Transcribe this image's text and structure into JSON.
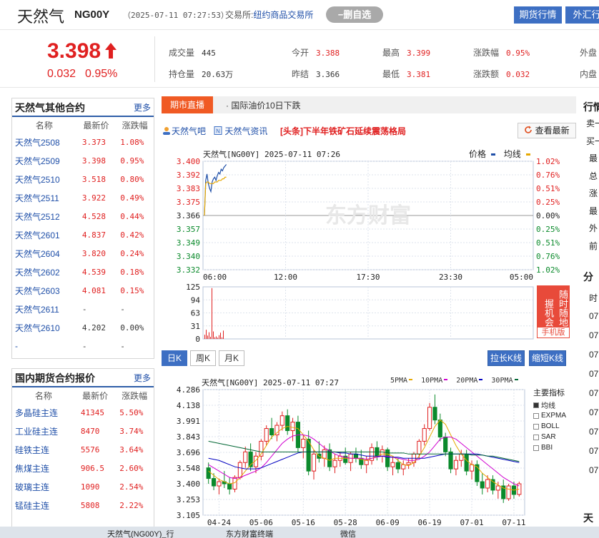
{
  "header": {
    "name": "天然气",
    "code": "NG00Y",
    "time": "（2025-07-11 07:27:53）",
    "exchange_label": "交易所:",
    "exchange": "纽约商品交易所",
    "watch_btn": "−删自选",
    "btn_futures": "期货行情",
    "btn_fx": "外汇行"
  },
  "quote": {
    "price": "3.398",
    "change": "0.032",
    "change_pct": "0.95%",
    "items": [
      {
        "label": "成交量",
        "value": "445"
      },
      {
        "label": "持仓量",
        "value": "20.63万"
      },
      {
        "label": "今开",
        "value": "3.388"
      },
      {
        "label": "昨结",
        "value": "3.366"
      },
      {
        "label": "最高",
        "value": "3.399"
      },
      {
        "label": "最低",
        "value": "3.381"
      },
      {
        "label": "涨跌幅",
        "value": "0.95%"
      },
      {
        "label": "涨跌额",
        "value": "0.032"
      },
      {
        "label": "外盘",
        "value": ""
      },
      {
        "label": "内盘",
        "value": ""
      }
    ]
  },
  "other_contracts": {
    "title": "天然气其他合约",
    "more": "更多",
    "headers": [
      "名称",
      "最新价",
      "涨跌幅"
    ],
    "rows": [
      [
        "天然气2508",
        "3.373",
        "1.08%"
      ],
      [
        "天然气2509",
        "3.398",
        "0.95%"
      ],
      [
        "天然气2510",
        "3.518",
        "0.80%"
      ],
      [
        "天然气2511",
        "3.922",
        "0.49%"
      ],
      [
        "天然气2512",
        "4.528",
        "0.44%"
      ],
      [
        "天然气2601",
        "4.837",
        "0.42%"
      ],
      [
        "天然气2604",
        "3.820",
        "0.24%"
      ],
      [
        "天然气2602",
        "4.539",
        "0.18%"
      ],
      [
        "天然气2603",
        "4.081",
        "0.15%"
      ],
      [
        "天然气2611",
        "-",
        "-"
      ],
      [
        "天然气2610",
        "4.202",
        "0.00%"
      ],
      [
        "-",
        "-",
        "-"
      ]
    ]
  },
  "domestic": {
    "title": "国内期货合约报价",
    "more": "更多",
    "headers": [
      "名称",
      "最新价",
      "涨跌幅"
    ],
    "rows": [
      [
        "多晶硅主连",
        "41345",
        "5.50%"
      ],
      [
        "工业硅主连",
        "8470",
        "3.74%"
      ],
      [
        "硅铁主连",
        "5576",
        "3.64%"
      ],
      [
        "焦煤主连",
        "906.5",
        "2.60%"
      ],
      [
        "玻璃主连",
        "1090",
        "2.54%"
      ],
      [
        "锰硅主连",
        "5808",
        "2.22%"
      ]
    ]
  },
  "news": {
    "tag": "期市直播",
    "ticker": "· 国际油价10日下跌",
    "link1": "天然气吧",
    "link2": "天然气资讯",
    "headline": "[头条]下半年铁矿石延续震荡格局",
    "refresh": "查看最新"
  },
  "intraday": {
    "title": "天然气[NG00Y] 2025-07-11 07:26",
    "legend_price": "价格",
    "legend_avg": "均线",
    "ad_text": "随时随地把握机会",
    "ad_label": "手机版",
    "watermark": "东方财富"
  },
  "kline_tabs": {
    "tabs": [
      "日K",
      "周K",
      "月K"
    ],
    "btn_wide": "拉长K线",
    "btn_narrow": "缩短K线"
  },
  "kline": {
    "title": "天然气[NG00Y] 2025-07-11 07:27",
    "ma": [
      "5PMA",
      "10PMA",
      "20PMA",
      "30PMA"
    ],
    "indicator_title": "主要指标",
    "indicators": [
      "均线",
      "EXPMA",
      "BOLL",
      "SAR",
      "BBI"
    ]
  },
  "right_panel": {
    "title1": "行情",
    "rows1": [
      "卖一",
      "买一",
      "最",
      "总",
      "涨",
      "最",
      "外",
      "前"
    ],
    "title2": "分",
    "rows2": [
      "时",
      "07",
      "07",
      "07",
      "07",
      "07",
      "07",
      "07",
      "07",
      "07"
    ],
    "title3": "天"
  },
  "taskbar": [
    "天然气(NG00Y)_行",
    "东方财富终端",
    "微信"
  ],
  "colors": {
    "up": "#e02020",
    "down": "#0b8a2c",
    "accent": "#3d6fc3",
    "tag": "#f05a24"
  },
  "chart_data": [
    {
      "type": "line",
      "title": "天然气[NG00Y] 2025-07-11 07:26",
      "x_ticks": [
        "06:00",
        "12:00",
        "17:30",
        "23:30",
        "05:00"
      ],
      "y_ticks_left": [
        "3.400",
        "3.392",
        "3.383",
        "3.375",
        "3.366",
        "3.357",
        "3.349",
        "3.340",
        "3.332"
      ],
      "y_ticks_right": [
        "1.02%",
        "0.76%",
        "0.51%",
        "0.25%",
        "0.00%",
        "0.25%",
        "0.51%",
        "0.76%",
        "1.02%"
      ],
      "ylim": [
        3.332,
        3.4
      ],
      "series": [
        {
          "name": "价格",
          "values": [
            3.366,
            3.388,
            3.392,
            3.386,
            3.383,
            3.381,
            3.387,
            3.389,
            3.39,
            3.388,
            3.391,
            3.393,
            3.392,
            3.395,
            3.394,
            3.396,
            3.397,
            3.398
          ]
        },
        {
          "name": "均线",
          "values": [
            3.366,
            3.386,
            3.387,
            3.387,
            3.386,
            3.386,
            3.386,
            3.386,
            3.387,
            3.387,
            3.387,
            3.388,
            3.388,
            3.388,
            3.389,
            3.389,
            3.39,
            3.39
          ]
        }
      ]
    },
    {
      "type": "bar",
      "yticks": [
        "125",
        "94",
        "63",
        "31",
        "0"
      ],
      "ylim": [
        0,
        125
      ],
      "values": [
        10,
        22,
        8,
        16,
        5,
        122,
        18,
        4,
        6,
        3,
        9,
        15,
        4,
        20
      ]
    },
    {
      "type": "candlestick",
      "title": "天然气[NG00Y] 2025-07-11 07:27",
      "y_ticks": [
        "4.286",
        "4.138",
        "3.991",
        "3.843",
        "3.696",
        "3.548",
        "3.400",
        "3.253",
        "3.105"
      ],
      "ylim": [
        3.105,
        4.286
      ],
      "x_ticks": [
        "04-24",
        "05-06",
        "05-16",
        "05-28",
        "06-09",
        "06-19",
        "07-01",
        "07-11"
      ],
      "ohlc": [
        [
          3.55,
          3.6,
          3.4,
          3.45
        ],
        [
          3.45,
          3.5,
          3.34,
          3.38
        ],
        [
          3.38,
          3.45,
          3.3,
          3.42
        ],
        [
          3.42,
          3.52,
          3.36,
          3.4
        ],
        [
          3.4,
          3.46,
          3.3,
          3.35
        ],
        [
          3.35,
          3.48,
          3.32,
          3.46
        ],
        [
          3.46,
          3.62,
          3.44,
          3.6
        ],
        [
          3.6,
          3.75,
          3.55,
          3.7
        ],
        [
          3.7,
          3.78,
          3.52,
          3.56
        ],
        [
          3.56,
          3.7,
          3.5,
          3.66
        ],
        [
          3.66,
          3.82,
          3.62,
          3.8
        ],
        [
          3.8,
          3.95,
          3.76,
          3.92
        ],
        [
          3.92,
          4.02,
          3.82,
          3.86
        ],
        [
          3.86,
          3.98,
          3.8,
          3.95
        ],
        [
          3.95,
          4.08,
          3.9,
          4.04
        ],
        [
          4.04,
          4.1,
          3.86,
          3.9
        ],
        [
          3.9,
          4.02,
          3.8,
          3.98
        ],
        [
          3.98,
          4.04,
          3.7,
          3.74
        ],
        [
          3.74,
          3.86,
          3.64,
          3.82
        ],
        [
          3.82,
          3.9,
          3.48,
          3.52
        ],
        [
          3.52,
          3.72,
          3.44,
          3.68
        ],
        [
          3.68,
          3.8,
          3.6,
          3.64
        ],
        [
          3.64,
          3.76,
          3.56,
          3.72
        ],
        [
          3.72,
          3.78,
          3.52,
          3.56
        ],
        [
          3.56,
          3.68,
          3.5,
          3.62
        ],
        [
          3.62,
          3.7,
          3.56,
          3.66
        ],
        [
          3.66,
          3.74,
          3.58,
          3.6
        ],
        [
          3.6,
          3.7,
          3.52,
          3.68
        ],
        [
          3.68,
          3.74,
          3.6,
          3.64
        ],
        [
          3.64,
          3.72,
          3.54,
          3.58
        ],
        [
          3.58,
          3.66,
          3.5,
          3.62
        ],
        [
          3.62,
          3.78,
          3.58,
          3.74
        ],
        [
          3.74,
          3.8,
          3.62,
          3.66
        ],
        [
          3.66,
          3.76,
          3.6,
          3.72
        ],
        [
          3.72,
          3.74,
          3.52,
          3.56
        ],
        [
          3.56,
          3.66,
          3.48,
          3.6
        ],
        [
          3.6,
          3.64,
          3.5,
          3.54
        ],
        [
          3.54,
          3.62,
          3.48,
          3.58
        ],
        [
          3.58,
          3.64,
          3.54,
          3.6
        ],
        [
          3.6,
          3.7,
          3.56,
          3.68
        ],
        [
          3.68,
          3.82,
          3.64,
          3.8
        ],
        [
          3.8,
          3.96,
          3.76,
          3.92
        ],
        [
          3.92,
          4.16,
          3.9,
          4.12
        ],
        [
          4.12,
          4.24,
          3.96,
          4.0
        ],
        [
          4.0,
          4.06,
          3.8,
          3.84
        ],
        [
          3.84,
          3.88,
          3.66,
          3.7
        ],
        [
          3.7,
          3.74,
          3.5,
          3.54
        ],
        [
          3.54,
          3.66,
          3.48,
          3.62
        ],
        [
          3.62,
          3.72,
          3.56,
          3.68
        ],
        [
          3.68,
          3.72,
          3.48,
          3.52
        ],
        [
          3.52,
          3.62,
          3.44,
          3.58
        ],
        [
          3.58,
          3.62,
          3.38,
          3.42
        ],
        [
          3.42,
          3.5,
          3.3,
          3.36
        ],
        [
          3.36,
          3.48,
          3.32,
          3.44
        ],
        [
          3.44,
          3.48,
          3.3,
          3.34
        ],
        [
          3.34,
          3.42,
          3.26,
          3.38
        ],
        [
          3.38,
          3.44,
          3.22,
          3.26
        ],
        [
          3.26,
          3.4,
          3.24,
          3.38
        ],
        [
          3.38,
          3.42,
          3.26,
          3.3
        ],
        [
          3.3,
          3.42,
          3.28,
          3.4
        ]
      ],
      "ma_series": [
        {
          "name": "5PMA",
          "color": "#e6a800",
          "values": [
            3.52,
            3.48,
            3.44,
            3.42,
            3.4,
            3.41,
            3.46,
            3.52,
            3.58,
            3.62,
            3.68,
            3.76,
            3.84,
            3.88,
            3.92,
            3.94,
            3.93,
            3.92,
            3.86,
            3.8,
            3.72,
            3.66,
            3.64,
            3.62,
            3.64,
            3.64,
            3.64,
            3.64,
            3.64,
            3.63,
            3.62,
            3.64,
            3.66,
            3.68,
            3.68,
            3.66,
            3.62,
            3.58,
            3.57,
            3.6,
            3.66,
            3.74,
            3.84,
            3.94,
            4.0,
            3.96,
            3.86,
            3.76,
            3.68,
            3.62,
            3.58,
            3.56,
            3.5,
            3.46,
            3.42,
            3.39,
            3.36,
            3.35,
            3.34,
            3.35
          ]
        },
        {
          "name": "10PMA",
          "color": "#d000d0",
          "values": [
            3.58,
            3.55,
            3.52,
            3.49,
            3.46,
            3.45,
            3.46,
            3.48,
            3.5,
            3.52,
            3.55,
            3.6,
            3.66,
            3.72,
            3.78,
            3.82,
            3.85,
            3.86,
            3.86,
            3.85,
            3.82,
            3.78,
            3.74,
            3.71,
            3.68,
            3.66,
            3.65,
            3.64,
            3.64,
            3.64,
            3.63,
            3.64,
            3.65,
            3.66,
            3.66,
            3.65,
            3.64,
            3.63,
            3.62,
            3.62,
            3.63,
            3.66,
            3.7,
            3.76,
            3.82,
            3.84,
            3.84,
            3.82,
            3.78,
            3.74,
            3.7,
            3.66,
            3.62,
            3.58,
            3.54,
            3.5,
            3.46,
            3.43,
            3.4,
            3.38
          ]
        },
        {
          "name": "20PMA",
          "color": "#0000c0",
          "values": [
            3.64,
            3.63,
            3.62,
            3.6,
            3.58,
            3.56,
            3.55,
            3.54,
            3.54,
            3.54,
            3.55,
            3.57,
            3.59,
            3.61,
            3.63,
            3.65,
            3.67,
            3.69,
            3.7,
            3.7,
            3.7,
            3.7,
            3.7,
            3.7,
            3.7,
            3.69,
            3.69,
            3.68,
            3.68,
            3.67,
            3.66,
            3.66,
            3.66,
            3.66,
            3.65,
            3.65,
            3.65,
            3.64,
            3.64,
            3.64,
            3.64,
            3.64,
            3.65,
            3.66,
            3.67,
            3.68,
            3.68,
            3.68,
            3.68,
            3.68,
            3.68,
            3.68,
            3.67,
            3.66,
            3.65,
            3.64,
            3.63,
            3.62,
            3.61,
            3.6
          ]
        },
        {
          "name": "30PMA",
          "color": "#006633",
          "values": [
            3.8,
            3.79,
            3.78,
            3.77,
            3.76,
            3.75,
            3.74,
            3.73,
            3.72,
            3.71,
            3.7,
            3.7,
            3.7,
            3.7,
            3.7,
            3.7,
            3.7,
            3.7,
            3.7,
            3.7,
            3.7,
            3.7,
            3.7,
            3.7,
            3.7,
            3.7,
            3.7,
            3.7,
            3.7,
            3.7,
            3.7,
            3.7,
            3.7,
            3.7,
            3.69,
            3.69,
            3.69,
            3.69,
            3.68,
            3.68,
            3.68,
            3.68,
            3.68,
            3.68,
            3.68,
            3.68,
            3.68,
            3.68,
            3.68,
            3.68,
            3.67,
            3.67,
            3.67,
            3.66,
            3.66,
            3.65,
            3.64,
            3.63,
            3.62,
            3.61
          ]
        }
      ]
    }
  ]
}
